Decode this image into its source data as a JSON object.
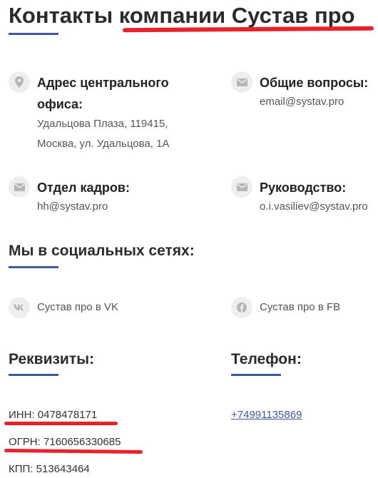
{
  "title": "Контакты компании Сустав про",
  "accent_color": "#3c5a9a",
  "highlight_color": "#e8212b",
  "contacts": {
    "office": {
      "icon": "map-pin-icon",
      "label_line1": "Адрес центрального",
      "label_line2": "офиса:",
      "address_line1": "Удальцова Плаза, 119415,",
      "address_line2": "Москва, ул. Удальцова, 1А"
    },
    "general": {
      "icon": "envelope-icon",
      "label": "Общие вопросы:",
      "value": "email@systav.pro"
    },
    "hr": {
      "icon": "envelope-icon",
      "label": "Отдел кадров:",
      "value": "hh@systav.pro"
    },
    "management": {
      "icon": "envelope-icon",
      "label": "Руководство:",
      "value": "o.i.vasiliev@systav.pro"
    }
  },
  "social": {
    "heading": "Мы в социальных сетях:",
    "vk": {
      "icon": "vk-icon",
      "label": "Сустав про в VK"
    },
    "fb": {
      "icon": "facebook-icon",
      "label": "Сустав про в FB"
    }
  },
  "requisites": {
    "heading": "Реквизиты:",
    "inn": "ИНН: 0478478171",
    "ogrn": "ОГРН: 7160656330685",
    "kpp": "КПП: 513643464"
  },
  "phone": {
    "heading": "Телефон:",
    "number": "+74991135869"
  }
}
